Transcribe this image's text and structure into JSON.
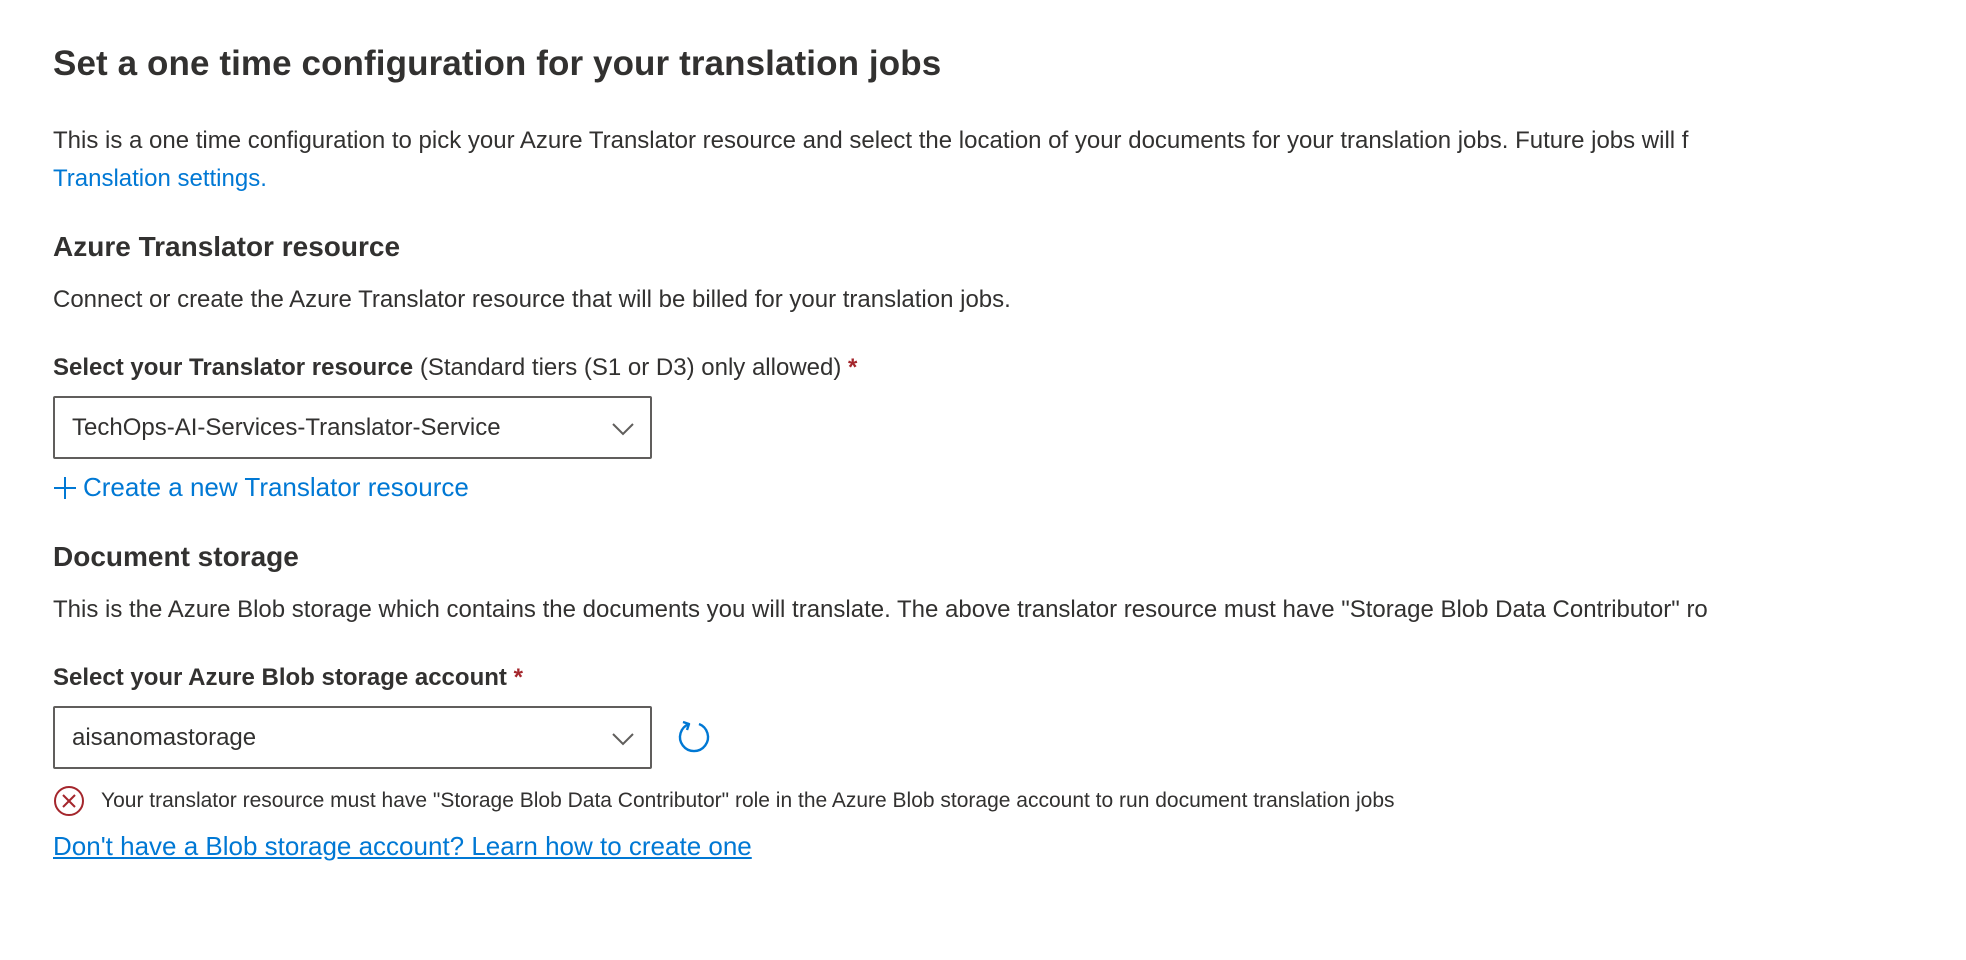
{
  "header": {
    "title": "Set a one time configuration for your translation jobs",
    "intro_text": "This is a one time configuration to pick your Azure Translator resource and select the location of your documents for your translation jobs. Future jobs will f",
    "intro_link": "Translation settings."
  },
  "translator_section": {
    "heading": "Azure Translator resource",
    "description": "Connect or create the Azure Translator resource that will be billed for your translation jobs.",
    "field_label": "Select your Translator resource",
    "field_hint": "(Standard tiers (S1 or D3) only allowed)",
    "required_mark": "*",
    "selected_value": "TechOps-AI-Services-Translator-Service",
    "create_link": "Create a new Translator resource"
  },
  "storage_section": {
    "heading": "Document storage",
    "description": "This is the Azure Blob storage which contains the documents you will translate. The above translator resource must have \"Storage Blob Data Contributor\" ro",
    "field_label": "Select your Azure Blob storage account",
    "required_mark": "*",
    "selected_value": "aisanomastorage",
    "error_message": "Your translator resource must have \"Storage Blob Data Contributor\" role in the Azure Blob storage account to run document translation jobs",
    "learn_link": "Don't have a Blob storage account? Learn how to create one"
  },
  "icons": {
    "dropdown": "chevron-down-icon",
    "add": "plus-icon",
    "refresh": "refresh-icon",
    "error": "error-circle-icon"
  },
  "colors": {
    "link": "#0078d4",
    "required": "#a4262c",
    "error": "#a4262c",
    "text": "#323130",
    "border": "#605e5c"
  }
}
